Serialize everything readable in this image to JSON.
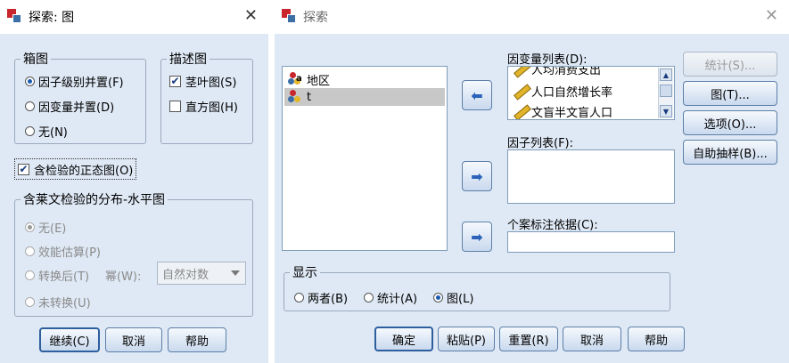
{
  "left_dialog": {
    "title": "探索: 图",
    "boxplot": {
      "legend": "箱图",
      "options": [
        "因子级别并置(F)",
        "因变量并置(D)",
        "无(N)"
      ],
      "selected": 0
    },
    "descriptive": {
      "legend": "描述图",
      "options": [
        {
          "label": "茎叶图(S)",
          "checked": true
        },
        {
          "label": "直方图(H)",
          "checked": false
        }
      ]
    },
    "normality": {
      "label": "含检验的正态图(O)",
      "checked": true
    },
    "spread": {
      "legend": "含莱文检验的分布-水平图",
      "options": [
        "无(E)",
        "效能估算(P)",
        "转换后(T)",
        "未转换(U)"
      ],
      "selected": 0,
      "power_label": "幂(W):",
      "power_value": "自然对数"
    },
    "buttons": {
      "continue": "继续(C)",
      "cancel": "取消",
      "help": "帮助"
    }
  },
  "right_dialog": {
    "title": "探索",
    "source_vars": [
      {
        "name": "地区",
        "icon": "nominal-string-icon",
        "selected": false
      },
      {
        "name": "t",
        "icon": "nominal-icon",
        "selected": true
      }
    ],
    "dependent": {
      "label": "因变量列表(D):",
      "items": [
        "人均消费支出",
        "人口自然增长率",
        "文盲半文盲人口"
      ]
    },
    "factor": {
      "label": "因子列表(F):"
    },
    "caselabel": {
      "label": "个案标注依据(C):"
    },
    "side_buttons": {
      "stats": "统计(S)...",
      "plots": "图(T)...",
      "options": "选项(O)...",
      "bootstrap": "自助抽样(B)..."
    },
    "display": {
      "legend": "显示",
      "options": [
        "两者(B)",
        "统计(A)",
        "图(L)"
      ],
      "selected": 2
    },
    "buttons": {
      "ok": "确定",
      "paste": "粘贴(P)",
      "reset": "重置(R)",
      "cancel": "取消",
      "help": "帮助"
    }
  }
}
